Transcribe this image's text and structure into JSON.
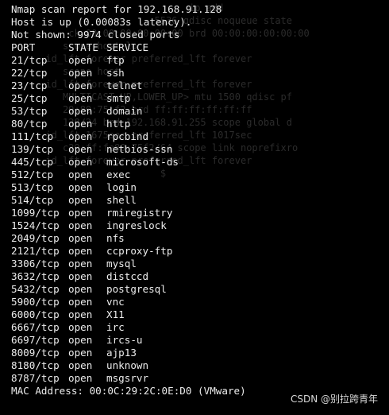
{
  "ghost_lines": [
    "                               ip add",
    "                         5536 qdisc noqueue state",
    "          ck 00:00:00:00:00:00 brd 00:00:00:00:00:00",
    "         scope host lo",
    "      id_lft forever preferred_lft forever",
    "         scope host",
    "      id_lft forever preferred_lft forever",
    "         MULTICAST,UP,LOWER_UP> mtu 1500 qdisc pf",
    "         29:80:75:f2 brd ff:ff:ff:ff:ff:ff",
    "         128/24 brd 192.168.91.255 scope global d",
    "      id_lft 1675sec preferred_lft 1017sec",
    "         c29:ff:fe80:75f2/64 scope link noprefixro",
    "      id_lft forever preferred_lft forever",
    "                          $"
  ],
  "header_lines": [
    "Nmap scan report for 192.168.91.128",
    "Host is up (0.00083s latency).",
    "Not shown: 9974 closed ports"
  ],
  "columns": {
    "port": "PORT",
    "state": "STATE",
    "service": "SERVICE"
  },
  "ports": [
    {
      "port": "21/tcp",
      "state": "open",
      "service": "ftp"
    },
    {
      "port": "22/tcp",
      "state": "open",
      "service": "ssh"
    },
    {
      "port": "23/tcp",
      "state": "open",
      "service": "telnet"
    },
    {
      "port": "25/tcp",
      "state": "open",
      "service": "smtp"
    },
    {
      "port": "53/tcp",
      "state": "open",
      "service": "domain"
    },
    {
      "port": "80/tcp",
      "state": "open",
      "service": "http"
    },
    {
      "port": "111/tcp",
      "state": "open",
      "service": "rpcbind"
    },
    {
      "port": "139/tcp",
      "state": "open",
      "service": "netbios-ssn"
    },
    {
      "port": "445/tcp",
      "state": "open",
      "service": "microsoft-ds"
    },
    {
      "port": "512/tcp",
      "state": "open",
      "service": "exec"
    },
    {
      "port": "513/tcp",
      "state": "open",
      "service": "login"
    },
    {
      "port": "514/tcp",
      "state": "open",
      "service": "shell"
    },
    {
      "port": "1099/tcp",
      "state": "open",
      "service": "rmiregistry"
    },
    {
      "port": "1524/tcp",
      "state": "open",
      "service": "ingreslock"
    },
    {
      "port": "2049/tcp",
      "state": "open",
      "service": "nfs"
    },
    {
      "port": "2121/tcp",
      "state": "open",
      "service": "ccproxy-ftp"
    },
    {
      "port": "3306/tcp",
      "state": "open",
      "service": "mysql"
    },
    {
      "port": "3632/tcp",
      "state": "open",
      "service": "distccd"
    },
    {
      "port": "5432/tcp",
      "state": "open",
      "service": "postgresql"
    },
    {
      "port": "5900/tcp",
      "state": "open",
      "service": "vnc"
    },
    {
      "port": "6000/tcp",
      "state": "open",
      "service": "X11"
    },
    {
      "port": "6667/tcp",
      "state": "open",
      "service": "irc"
    },
    {
      "port": "6697/tcp",
      "state": "open",
      "service": "ircs-u"
    },
    {
      "port": "8009/tcp",
      "state": "open",
      "service": "ajp13"
    },
    {
      "port": "8180/tcp",
      "state": "open",
      "service": "unknown"
    },
    {
      "port": "8787/tcp",
      "state": "open",
      "service": "msgsrvr"
    }
  ],
  "footer_line": "MAC Address: 00:0C:29:2C:0E:D0 (VMware)",
  "watermark": "CSDN @别拉跨青年",
  "colors": {
    "background": "#000000",
    "text": "#ececec",
    "ghost": "#2b2b2b"
  }
}
